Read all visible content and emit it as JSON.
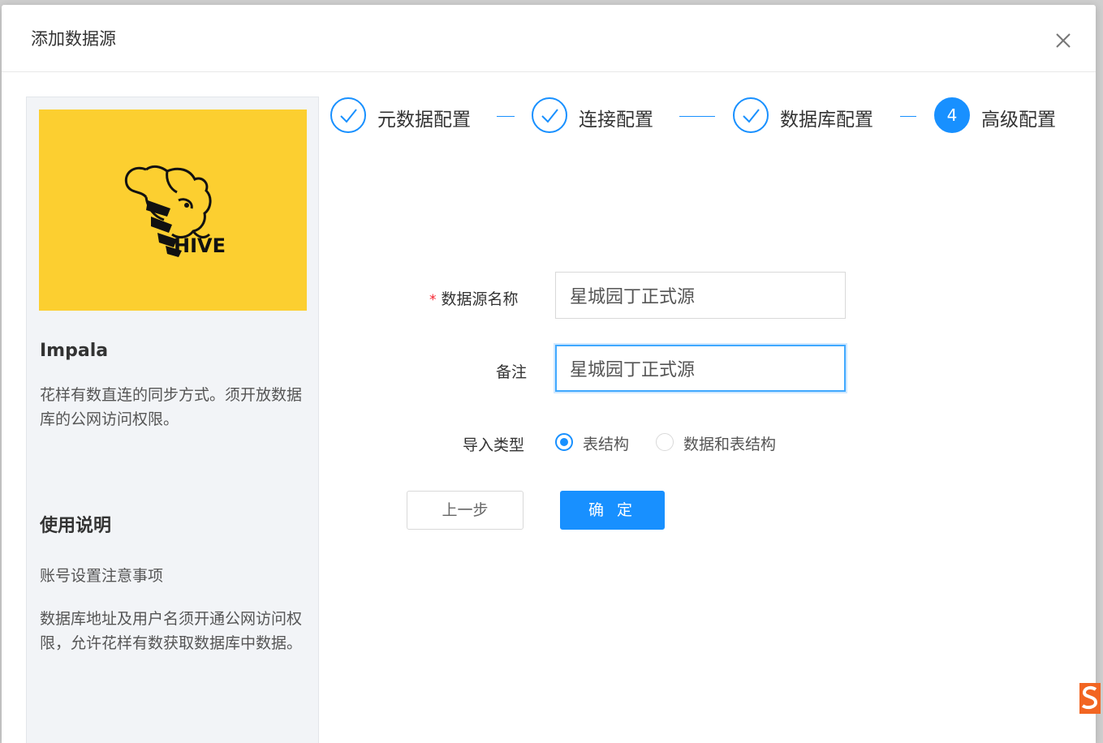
{
  "modal": {
    "title": "添加数据源"
  },
  "side_panel": {
    "logo_text": "HIVE",
    "source_name": "Impala",
    "source_desc": "花样有数直连的同步方式。须开放数据库的公网访问权限。",
    "usage_title": "使用说明",
    "usage_subtitle": "账号设置注意事项",
    "usage_desc": "数据库地址及用户名须开通公网访问权限，允许花样有数获取数据库中数据。"
  },
  "steps": [
    {
      "label": "元数据配置",
      "status": "done"
    },
    {
      "label": "连接配置",
      "status": "done"
    },
    {
      "label": "数据库配置",
      "status": "done"
    },
    {
      "label": "高级配置",
      "status": "active",
      "number": "4"
    }
  ],
  "form": {
    "name_label": "数据源名称",
    "name_required_mark": "*",
    "name_value": "星城园丁正式源",
    "remark_label": "备注",
    "remark_value": "星城园丁正式源",
    "import_type_label": "导入类型",
    "import_options": [
      {
        "label": "表结构",
        "checked": true
      },
      {
        "label": "数据和表结构",
        "checked": false
      }
    ]
  },
  "buttons": {
    "prev": "上一步",
    "confirm": "确 定"
  },
  "colors": {
    "primary": "#1890ff",
    "logo_bg": "#fccf30",
    "required": "#f5222d"
  }
}
